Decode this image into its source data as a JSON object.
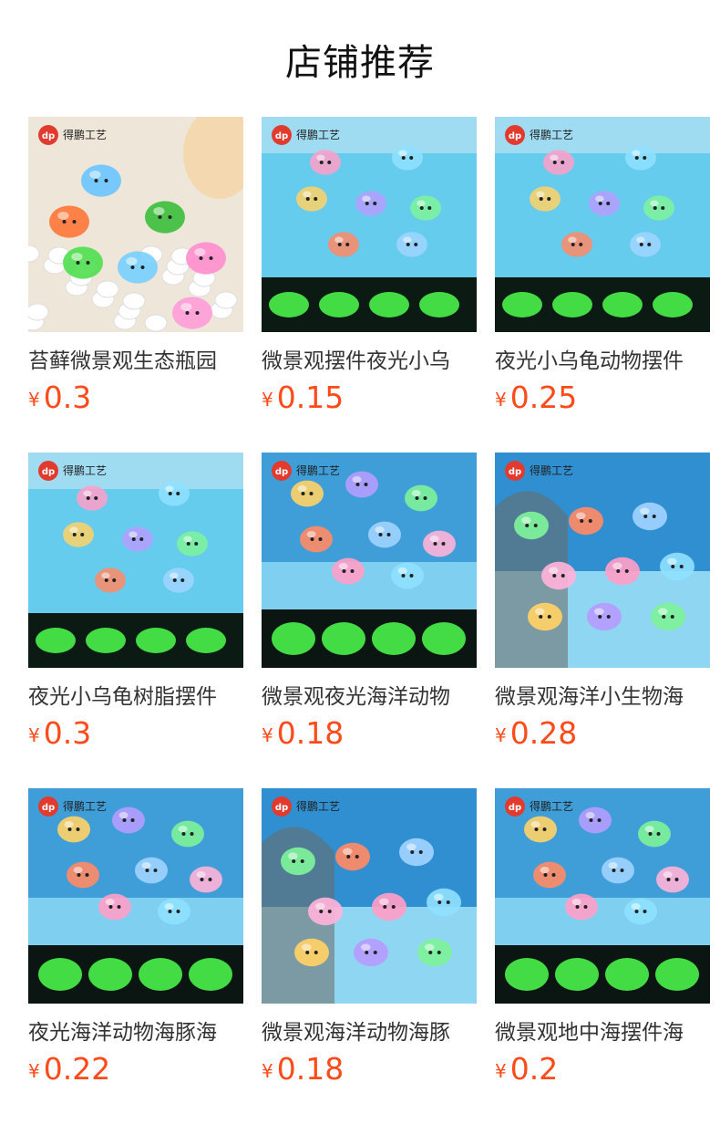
{
  "header": {
    "title": "店铺推荐"
  },
  "colors": {
    "price": "#ff4a1a",
    "glow": "#4dff4d",
    "sea": "#5ec8ee"
  },
  "logo": {
    "mark": "dp",
    "brand": "得鹏工艺"
  },
  "products": [
    {
      "name": "苔藓微景观生态瓶园",
      "currency": "¥",
      "price": "0.3",
      "scene": "beach-turtles"
    },
    {
      "name": "微景观摆件夜光小乌",
      "currency": "¥",
      "price": "0.15",
      "scene": "glow-turtles"
    },
    {
      "name": "夜光小乌龟动物摆件",
      "currency": "¥",
      "price": "0.25",
      "scene": "glow-turtles"
    },
    {
      "name": "夜光小乌龟树脂摆件",
      "currency": "¥",
      "price": "0.3",
      "scene": "glow-turtles"
    },
    {
      "name": "微景观夜光海洋动物",
      "currency": "¥",
      "price": "0.18",
      "scene": "glow-sea-animals"
    },
    {
      "name": "微景观海洋小生物海",
      "currency": "¥",
      "price": "0.28",
      "scene": "sea-animals"
    },
    {
      "name": "夜光海洋动物海豚海",
      "currency": "¥",
      "price": "0.22",
      "scene": "glow-sea-animals"
    },
    {
      "name": "微景观海洋动物海豚",
      "currency": "¥",
      "price": "0.18",
      "scene": "sea-animals"
    },
    {
      "name": "微景观地中海摆件海",
      "currency": "¥",
      "price": "0.2",
      "scene": "glow-sea-animals"
    }
  ]
}
